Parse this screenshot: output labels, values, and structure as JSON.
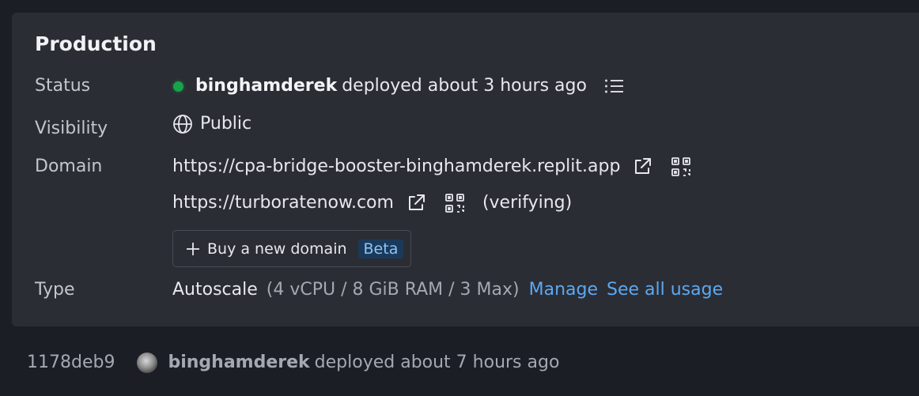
{
  "production": {
    "title": "Production",
    "status": {
      "label": "Status",
      "user": "binghamderek",
      "text": "deployed about 3 hours ago"
    },
    "visibility": {
      "label": "Visibility",
      "value": "Public"
    },
    "domain": {
      "label": "Domain",
      "primary_url": "https://cpa-bridge-booster-binghamderek.replit.app",
      "custom_url": "https://turboratenow.com",
      "custom_status": "(verifying)",
      "buy_label": "Buy a new domain",
      "beta_badge": "Beta"
    },
    "type": {
      "label": "Type",
      "value": "Autoscale",
      "spec": "(4 vCPU / 8 GiB RAM / 3 Max)",
      "manage_link": "Manage",
      "usage_link": "See all usage"
    }
  },
  "history": {
    "commit": "1178deb9",
    "user": "binghamderek",
    "text": "deployed about 7 hours ago"
  },
  "colors": {
    "background": "#1c1e26",
    "card": "#2b2d35",
    "status_dot": "#16a34a",
    "link": "#5ba9f2",
    "beta_bg": "#1b3a5b"
  },
  "icons": [
    "list-icon",
    "globe-icon",
    "external-link-icon",
    "qr-code-icon",
    "plus-icon",
    "avatar"
  ]
}
